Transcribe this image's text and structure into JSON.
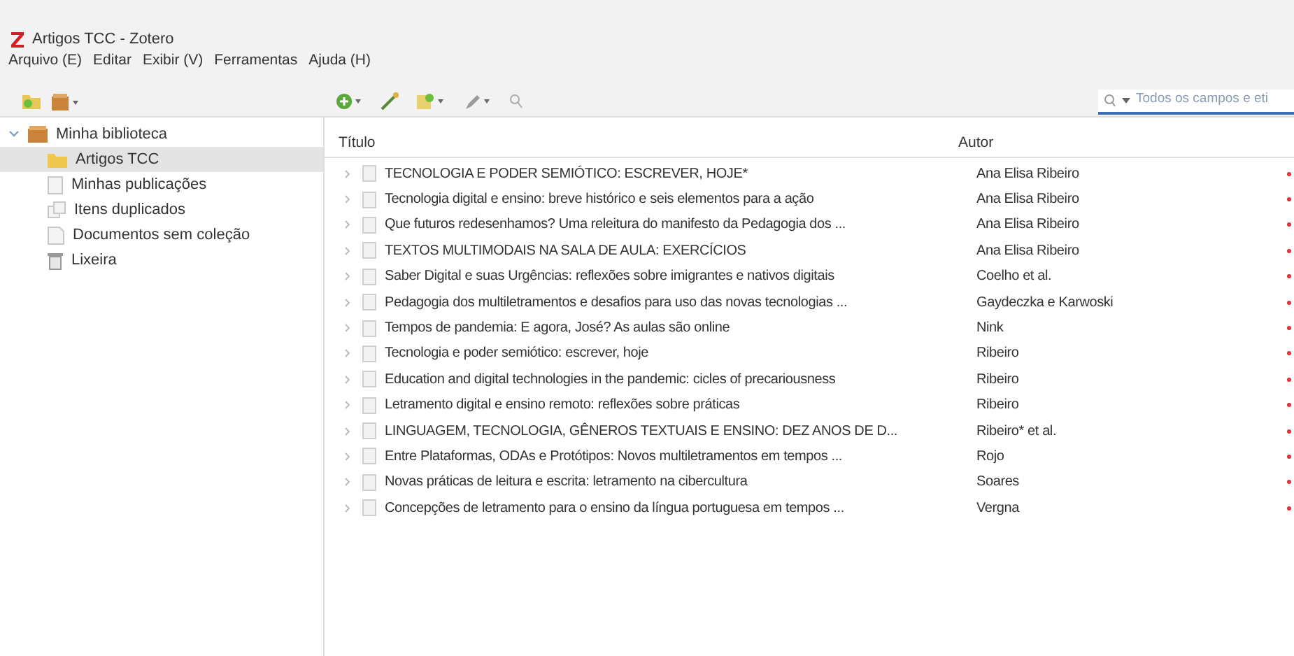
{
  "window": {
    "title": "Artigos TCC - Zotero"
  },
  "menu": [
    "Arquivo (E)",
    "Editar",
    "Exibir (V)",
    "Ferramentas",
    "Ajuda (H)"
  ],
  "search": {
    "placeholder": "Todos os campos e eti"
  },
  "sidebar": {
    "items": [
      {
        "label": "Minha biblioteca",
        "kind": "library",
        "expanded": true,
        "selected": false,
        "children": [
          {
            "label": "Artigos TCC",
            "kind": "folder",
            "selected": true
          },
          {
            "label": "Minhas publicações",
            "kind": "publications",
            "selected": false
          },
          {
            "label": "Itens duplicados",
            "kind": "duplicates",
            "selected": false
          },
          {
            "label": "Documentos sem coleção",
            "kind": "unfiled",
            "selected": false
          },
          {
            "label": "Lixeira",
            "kind": "trash",
            "selected": false
          }
        ]
      }
    ]
  },
  "table": {
    "columns": [
      "Título",
      "Autor"
    ],
    "rows": [
      {
        "title": "TECNOLOGIA E PODER SEMIÓTICO: ESCREVER, HOJE*",
        "author": "Ana Elisa Ribeiro"
      },
      {
        "title": "Tecnologia digital e ensino: breve histórico e seis elementos para a ação",
        "author": "Ana Elisa Ribeiro"
      },
      {
        "title": "Que futuros redesenhamos? Uma releitura do manifesto da Pedagogia dos ...",
        "author": "Ana Elisa Ribeiro"
      },
      {
        "title": "TEXTOS MULTIMODAIS NA SALA DE AULA: EXERCÍCIOS",
        "author": "Ana Elisa Ribeiro"
      },
      {
        "title": "Saber Digital e suas Urgências: reflexões sobre imigrantes e nativos digitais",
        "author": "Coelho et al."
      },
      {
        "title": "Pedagogia dos multiletramentos e desafios para uso das novas tecnologias ...",
        "author": "Gaydeczka e Karwoski"
      },
      {
        "title": "Tempos de pandemia: E agora, José? As aulas são online",
        "author": "Nink"
      },
      {
        "title": "Tecnologia e poder semiótico: escrever, hoje",
        "author": "Ribeiro"
      },
      {
        "title": "Education and digital technologies in the pandemic: cicles of precariousness",
        "author": "Ribeiro"
      },
      {
        "title": "Letramento digital e ensino remoto: reflexões sobre práticas",
        "author": "Ribeiro"
      },
      {
        "title": "LINGUAGEM, TECNOLOGIA, GÊNEROS TEXTUAIS E ENSINO: DEZ ANOS DE D...",
        "author": "Ribeiro* et al."
      },
      {
        "title": "Entre Plataformas, ODAs e Protótipos: Novos multiletramentos em tempos ...",
        "author": "Rojo"
      },
      {
        "title": "Novas práticas de leitura e escrita: letramento na cibercultura",
        "author": "Soares"
      },
      {
        "title": "Concepções de letramento para o ensino da língua portuguesa em tempos ...",
        "author": "Vergna"
      }
    ]
  }
}
